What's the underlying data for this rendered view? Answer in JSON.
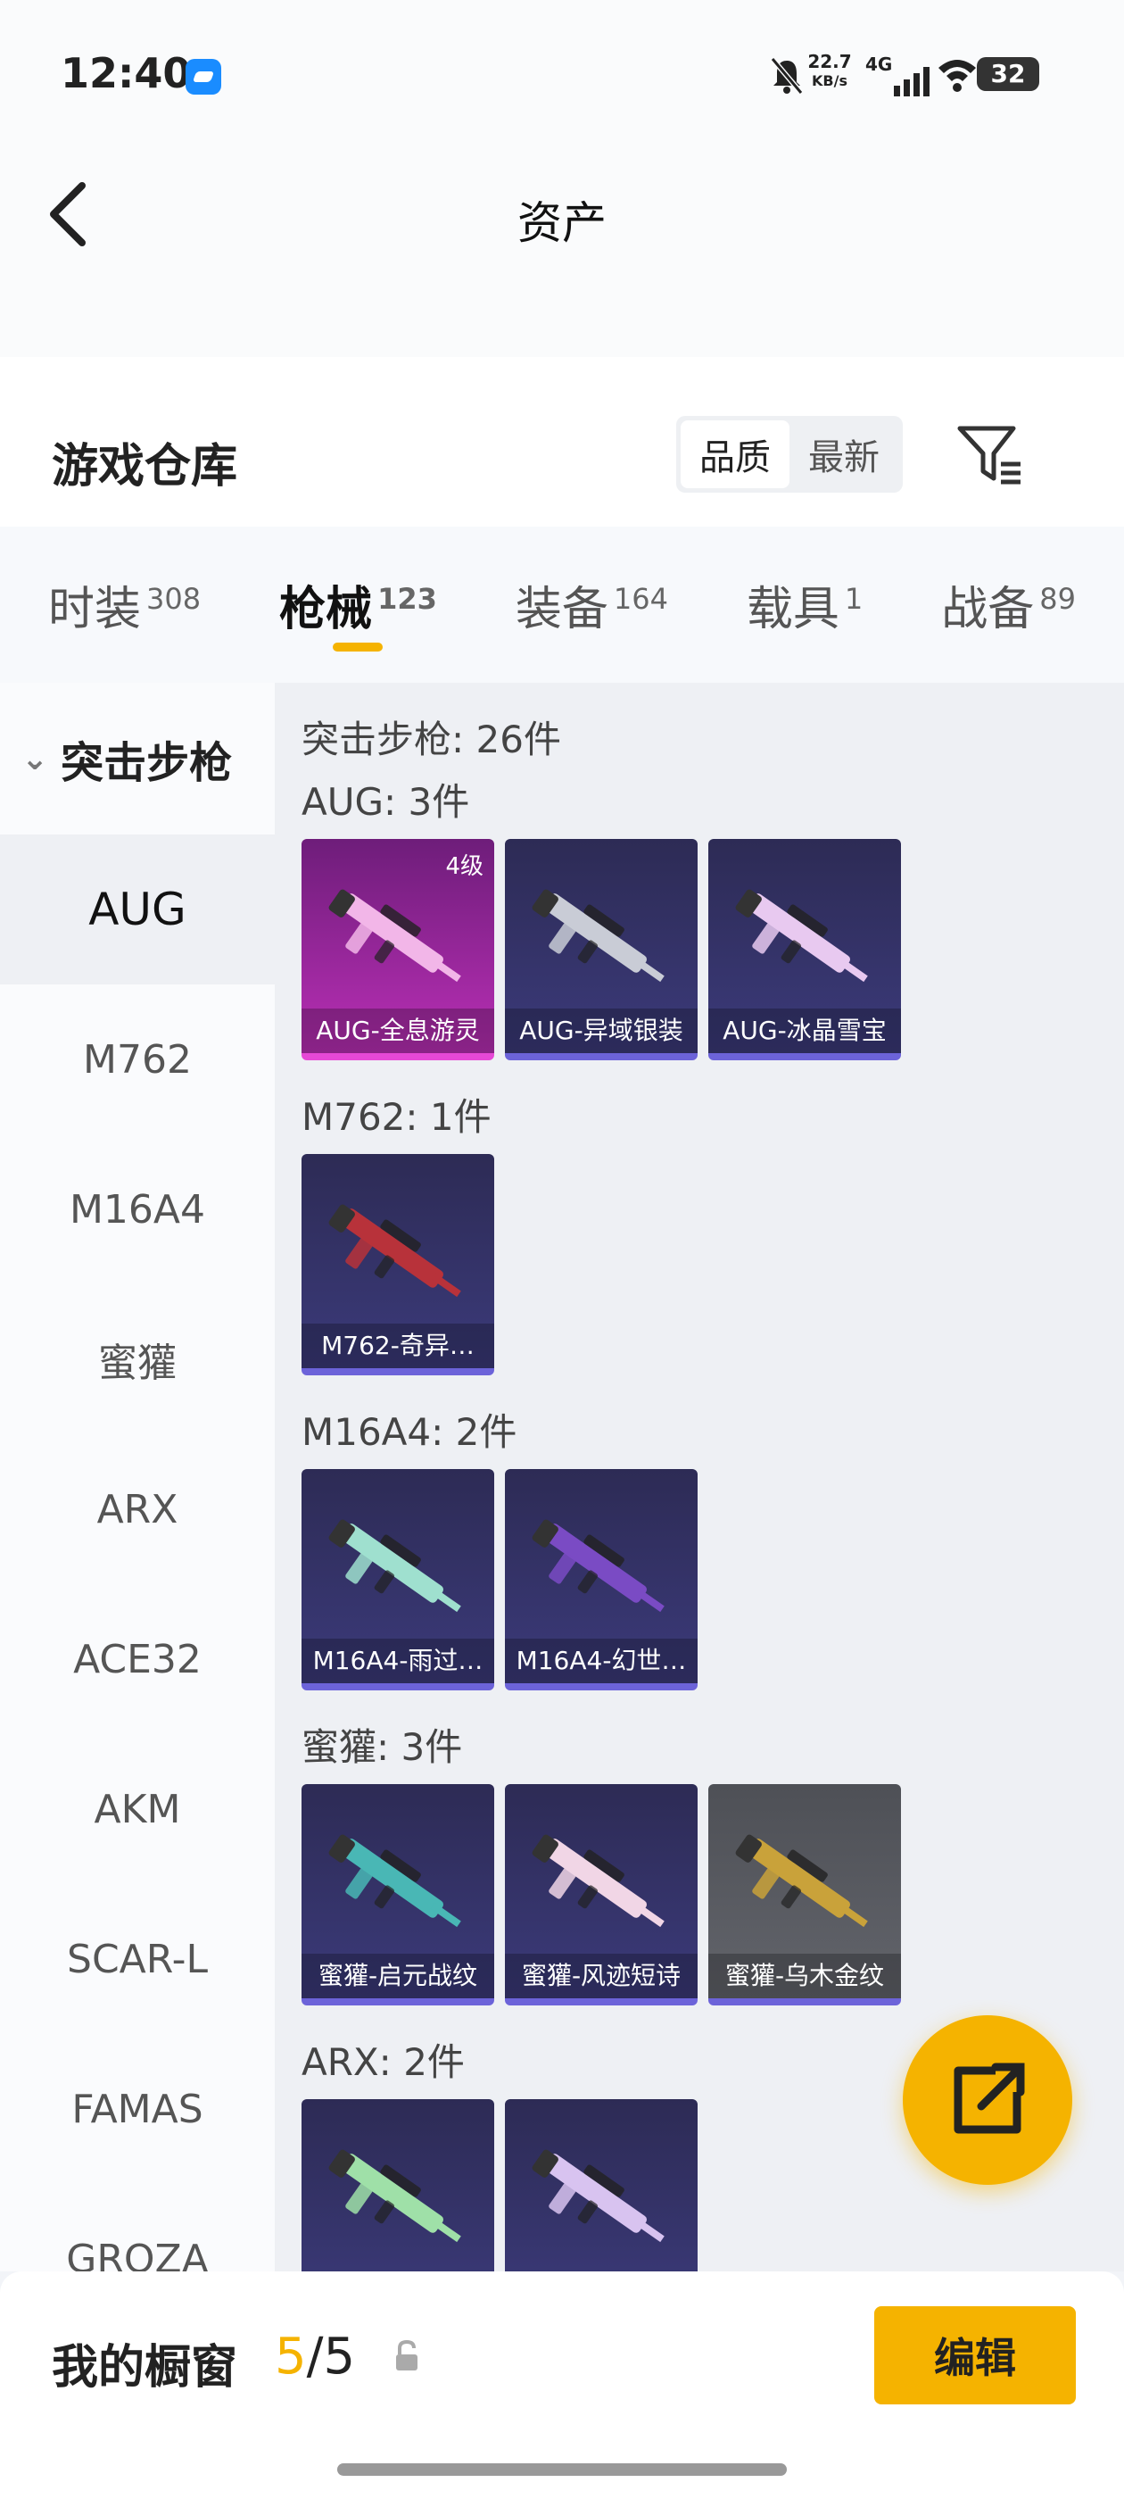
{
  "status": {
    "time": "12:40",
    "net_speed": "22.7",
    "net_unit": "KB/s",
    "network": "4G",
    "battery": "32"
  },
  "header": {
    "title": "资产"
  },
  "shelf": {
    "title": "游戏仓库",
    "sort_options": [
      "品质",
      "最新"
    ],
    "sort_selected": "品质"
  },
  "tabs": [
    {
      "label": "时装",
      "count": "308"
    },
    {
      "label": "枪械",
      "count": "123",
      "active": true
    },
    {
      "label": "装备",
      "count": "164"
    },
    {
      "label": "载具",
      "count": "1"
    },
    {
      "label": "战备",
      "count": "89"
    }
  ],
  "sidebar": {
    "category": "突击步枪",
    "items": [
      "AUG",
      "M762",
      "M16A4",
      "蜜獾",
      "ARX",
      "ACE32",
      "AKM",
      "SCAR-L",
      "FAMAS",
      "GROZA"
    ]
  },
  "main": {
    "title": "突击步枪: 26件",
    "groups": [
      {
        "title": "AUG: 3件",
        "items": [
          {
            "name": "AUG-全息游灵",
            "level": "4级",
            "style": "pink",
            "color": "#f2b6e8"
          },
          {
            "name": "AUG-异域银装",
            "style": "blue",
            "color": "#c9ccd6"
          },
          {
            "name": "AUG-冰晶雪宝",
            "style": "blue",
            "color": "#e8c9f0"
          }
        ]
      },
      {
        "title": "M762: 1件",
        "items": [
          {
            "name": "M762-奇异…",
            "style": "blue",
            "color": "#b8323a"
          }
        ]
      },
      {
        "title": "M16A4: 2件",
        "items": [
          {
            "name": "M16A4-雨过…",
            "style": "blue",
            "color": "#9fe0cf"
          },
          {
            "name": "M16A4-幻世…",
            "style": "blue",
            "color": "#7a4bc4"
          }
        ]
      },
      {
        "title": "蜜獾: 3件",
        "items": [
          {
            "name": "蜜獾-启元战纹",
            "style": "blue",
            "color": "#49b7b5"
          },
          {
            "name": "蜜獾-风迹短诗",
            "style": "blue",
            "color": "#f1d6e6"
          },
          {
            "name": "蜜獾-乌木金纹",
            "style": "gray",
            "color": "#c9a23a"
          }
        ]
      },
      {
        "title": "ARX: 2件",
        "items": [
          {
            "name": "",
            "style": "blue",
            "color": "#9fe0a8"
          },
          {
            "name": "",
            "style": "blue",
            "color": "#d8c3f0"
          }
        ]
      }
    ]
  },
  "showcase": {
    "label": "我的橱窗",
    "current": "5",
    "total": "/5",
    "edit_label": "编辑"
  },
  "colors": {
    "accent": "#f5b300"
  }
}
